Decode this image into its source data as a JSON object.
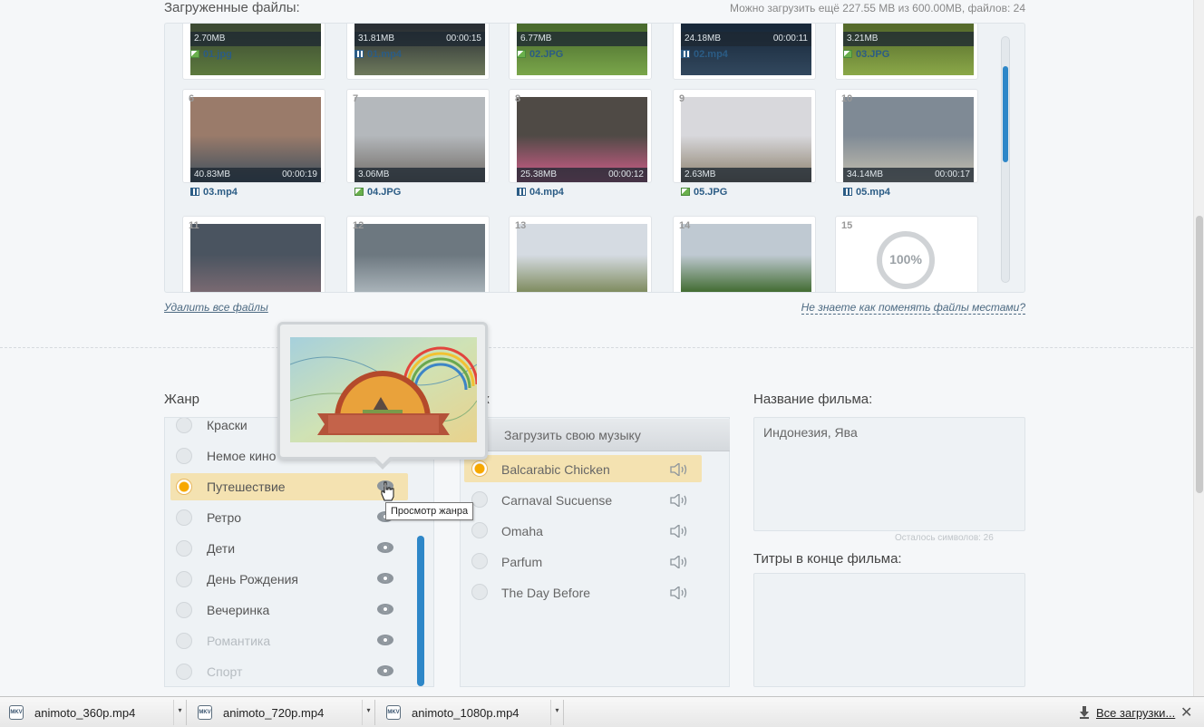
{
  "uploads": {
    "title": "Загруженные файлы:",
    "quota": "Можно загрузить ещё 227.55 MB из 600.00MB, файлов: 24",
    "files": [
      {
        "num": "",
        "size": "2.70MB",
        "duration": "",
        "name": "01.jpg",
        "kind": "image-icon"
      },
      {
        "num": "",
        "size": "31.81MB",
        "duration": "00:00:15",
        "name": "01.mp4",
        "kind": "video-icon"
      },
      {
        "num": "",
        "size": "6.77MB",
        "duration": "",
        "name": "02.JPG",
        "kind": "image-icon"
      },
      {
        "num": "",
        "size": "24.18MB",
        "duration": "00:00:11",
        "name": "02.mp4",
        "kind": "video-icon"
      },
      {
        "num": "",
        "size": "3.21MB",
        "duration": "",
        "name": "03.JPG",
        "kind": "image-icon"
      },
      {
        "num": "6",
        "size": "40.83MB",
        "duration": "00:00:19",
        "name": "03.mp4",
        "kind": "video-icon"
      },
      {
        "num": "7",
        "size": "3.06MB",
        "duration": "",
        "name": "04.JPG",
        "kind": "image-icon"
      },
      {
        "num": "8",
        "size": "25.38MB",
        "duration": "00:00:12",
        "name": "04.mp4",
        "kind": "video-icon"
      },
      {
        "num": "9",
        "size": "2.63MB",
        "duration": "",
        "name": "05.JPG",
        "kind": "image-icon"
      },
      {
        "num": "10",
        "size": "34.14MB",
        "duration": "00:00:17",
        "name": "05.mp4",
        "kind": "video-icon"
      },
      {
        "num": "11"
      },
      {
        "num": "12"
      },
      {
        "num": "13"
      },
      {
        "num": "14"
      },
      {
        "num": "15",
        "progress": "100%"
      }
    ],
    "delete_all": "Удалить все файлы",
    "swap_hint": "Не знаете как поменять файлы местами?"
  },
  "genre": {
    "label": "Жанр",
    "items": [
      {
        "label": "Краски"
      },
      {
        "label": "Немое кино"
      },
      {
        "label": "Путешествие",
        "selected": true
      },
      {
        "label": "Ретро"
      },
      {
        "label": "Дети"
      },
      {
        "label": "День Рождения"
      },
      {
        "label": "Вечеринка"
      },
      {
        "label": "Романтика"
      },
      {
        "label": "Спорт"
      }
    ],
    "preview_tooltip": "Просмотр жанра"
  },
  "music": {
    "label_suffix": "к",
    "upload_button": "Загрузить свою музыку",
    "tracks": [
      {
        "label": "Balcarabic Chicken",
        "selected": true
      },
      {
        "label": "Carnaval Sucuense"
      },
      {
        "label": "Omaha"
      },
      {
        "label": "Parfum"
      },
      {
        "label": "The Day Before"
      }
    ]
  },
  "film": {
    "title_label": "Название фильма:",
    "title_value": "Индонезия, Ява",
    "title_counter": "Осталось символов: 26",
    "credits_label": "Титры в конце фильма:",
    "credits_value": ""
  },
  "downloads": {
    "items": [
      {
        "name": "animoto_360p.mp4"
      },
      {
        "name": "animoto_720p.mp4"
      },
      {
        "name": "animoto_1080p.mp4"
      }
    ],
    "all_label": "Все загрузки...",
    "close": "✕",
    "menu_glyph": "▾",
    "file_badge": "MKV"
  },
  "colors": {
    "accent_blue": "#2e87c8",
    "selected_row": "#f4e2b1",
    "radio_on": "#f7a800"
  }
}
